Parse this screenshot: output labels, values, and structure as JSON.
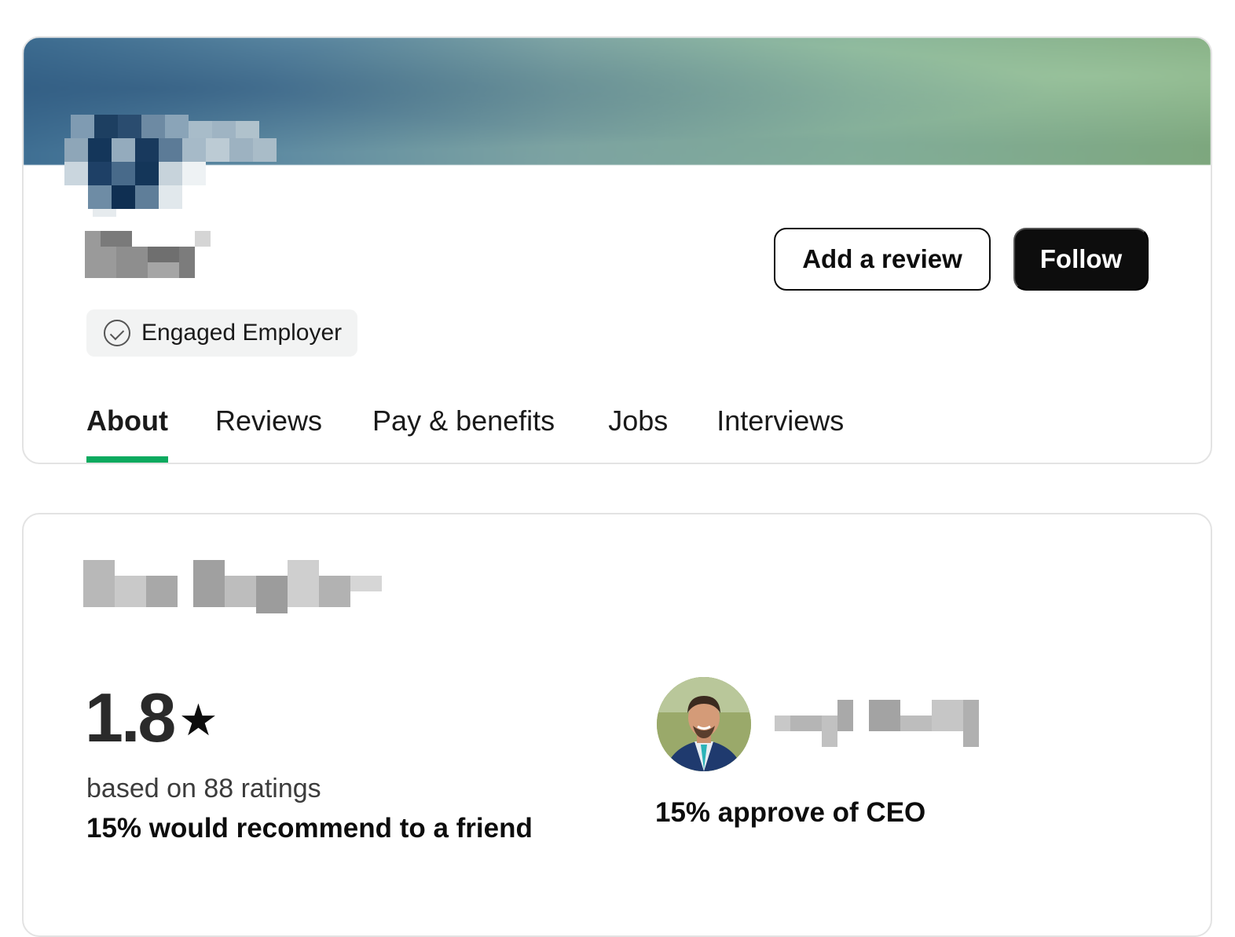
{
  "profile": {
    "badge_label": "Engaged Employer",
    "add_review_label": "Add a review",
    "follow_label": "Follow",
    "tabs": [
      {
        "label": "About",
        "active": true
      },
      {
        "label": "Reviews",
        "active": false
      },
      {
        "label": "Pay & benefits",
        "active": false
      },
      {
        "label": "Jobs",
        "active": false
      },
      {
        "label": "Interviews",
        "active": false
      }
    ],
    "accent_color": "#0caa5f"
  },
  "overview": {
    "rating_value": "1.8",
    "rating_star": "★",
    "ratings_count_text": "based on 88 ratings",
    "recommend_text": "15% would recommend to a friend",
    "ceo_approval_text": "15% approve of CEO"
  },
  "icons": {
    "badge": "check-circle-icon",
    "star": "star-icon"
  }
}
